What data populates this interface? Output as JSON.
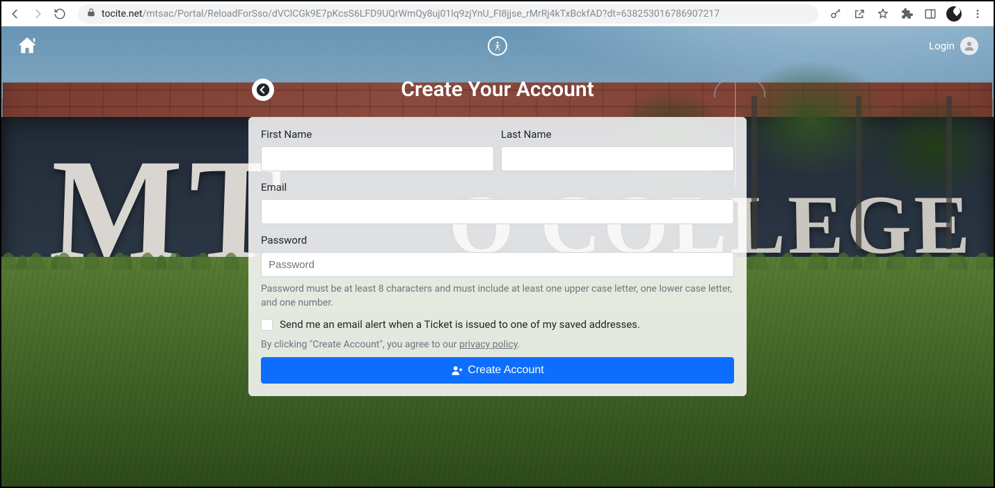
{
  "browser": {
    "url_host": "tocite.net",
    "url_path": "/mtsac/Portal/ReloadForSso/dVClCGk9E7pKcsS6LFD9UQrWmQy8uj01lq9zjYnU_FI8jjse_rMrRj4kTxBckfAD?dt=638253016786907217"
  },
  "header": {
    "login_label": "Login"
  },
  "form": {
    "title": "Create Your Account",
    "first_name_label": "First Name",
    "last_name_label": "Last Name",
    "email_label": "Email",
    "password_label": "Password",
    "password_placeholder": "Password",
    "password_help": "Password must be at least 8 characters and must include at least one upper case letter, one lower case letter, and one number.",
    "alert_checkbox_label": "Send me an email alert when a Ticket is issued to one of my saved addresses.",
    "agree_prefix": "By clicking \"Create Account\", you agree to our ",
    "privacy_link": "privacy policy",
    "agree_suffix": ".",
    "submit_label": "Create Account"
  },
  "background": {
    "sign_left": "MT",
    "sign_right": "O COLLEGE"
  }
}
